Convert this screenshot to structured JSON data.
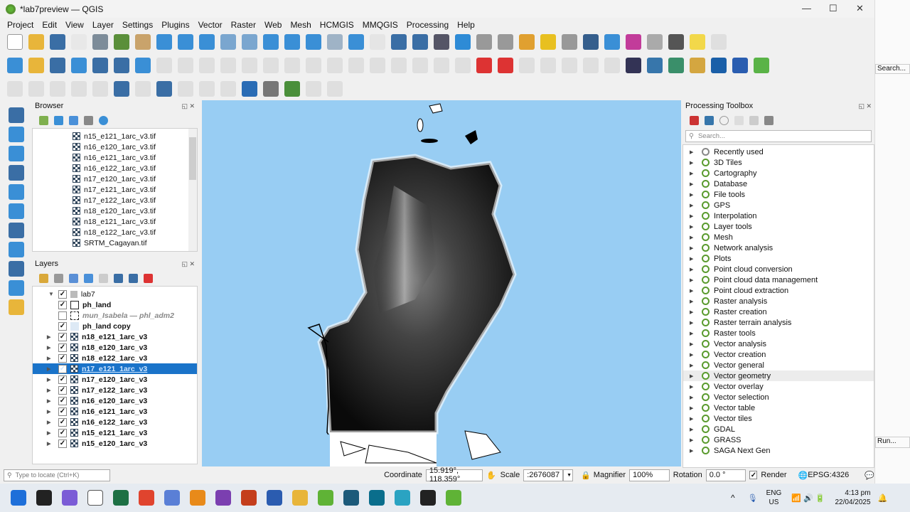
{
  "window": {
    "title": "*lab7preview — QGIS"
  },
  "menu": [
    "Project",
    "Edit",
    "View",
    "Layer",
    "Settings",
    "Plugins",
    "Vector",
    "Raster",
    "Web",
    "Mesh",
    "HCMGIS",
    "MMQGIS",
    "Processing",
    "Help"
  ],
  "toolbar_colors": {
    "row1": [
      "#fff",
      "#e8b53a",
      "#3a6ea5",
      "#e8e8e8",
      "#7d8c99",
      "#5a8f3a",
      "#c9a36b",
      "#3a8fd6",
      "#3a8fd6",
      "#3a8fd6",
      "#7aa6cf",
      "#7aa6cf",
      "#3a8fd6",
      "#3a8fd6",
      "#3a8fd6",
      "#9fb3c6",
      "#3a8fd6",
      "#ccc",
      "#3a6ea5",
      "#3a6ea5",
      "#556",
      "#2e8bd6",
      "#999",
      "#999",
      "#e0a030",
      "#e8c020",
      "#999",
      "#355e8c",
      "#3a8fd6",
      "#c23c9a",
      "#aaa",
      "#555",
      "#f2d84a",
      "#bbb"
    ],
    "row2": [
      "#3a8fd6",
      "#e8b53a",
      "#3a6ea5",
      "#3a8fd6",
      "#3a6ea5",
      "#3a6ea5",
      "#3a8fd6",
      "#bbb",
      "#bbb",
      "#bbb",
      "#bbb",
      "#bbb",
      "#bbb",
      "#bbb",
      "#bbb",
      "#bbb",
      "#bbb",
      "#bbb",
      "#bbb",
      "#bbb",
      "#bbb",
      "#bbb",
      "#d33",
      "#d33",
      "#bbb",
      "#bbb",
      "#bbb",
      "#bbb",
      "#bbb",
      "#335",
      "#3776ab",
      "#3a8f6a",
      "#d4a640",
      "#1a5fa8",
      "#2a5db0",
      "#5ab347"
    ],
    "row3": [
      "#bbb",
      "#bbb",
      "#bbb",
      "#bbb",
      "#bbb",
      "#3a6ea5",
      "#bbb",
      "#3a6ea5",
      "#bbb",
      "#bbb",
      "#bbb",
      "#2a6cb5",
      "#777",
      "#4a8f3a",
      "#bbb",
      "#bbb"
    ],
    "left": [
      "#3a6ea5",
      "#3a8fd6",
      "#3a8fd6",
      "#3a6ea5",
      "#3a8fd6",
      "#3a8fd6",
      "#3a6ea5",
      "#3a8fd6",
      "#3a6ea5",
      "#3a8fd6",
      "#e8b53a"
    ]
  },
  "browser": {
    "title": "Browser",
    "items": [
      "n15_e121_1arc_v3.tif",
      "n16_e120_1arc_v3.tif",
      "n16_e121_1arc_v3.tif",
      "n16_e122_1arc_v3.tif",
      "n17_e120_1arc_v3.tif",
      "n17_e121_1arc_v3.tif",
      "n17_e122_1arc_v3.tif",
      "n18_e120_1arc_v3.tif",
      "n18_e121_1arc_v3.tif",
      "n18_e122_1arc_v3.tif",
      "SRTM_Cagayan.tif"
    ]
  },
  "layers": {
    "title": "Layers",
    "group": "lab7",
    "items": [
      {
        "name": "ph_land",
        "checked": true,
        "type": "poly",
        "expand": false
      },
      {
        "name": "mun_Isabela — phl_adm2",
        "checked": false,
        "type": "dashed",
        "expand": false
      },
      {
        "name": "ph_land copy",
        "checked": true,
        "type": "fill",
        "expand": false
      },
      {
        "name": "n18_e121_1arc_v3",
        "checked": true,
        "type": "raster",
        "expand": true
      },
      {
        "name": "n18_e120_1arc_v3",
        "checked": true,
        "type": "raster",
        "expand": true
      },
      {
        "name": "n18_e122_1arc_v3",
        "checked": true,
        "type": "raster",
        "expand": true
      },
      {
        "name": "n17_e121_1arc_v3",
        "checked": true,
        "type": "raster",
        "expand": true,
        "selected": true
      },
      {
        "name": "n17_e120_1arc_v3",
        "checked": true,
        "type": "raster",
        "expand": true
      },
      {
        "name": "n17_e122_1arc_v3",
        "checked": true,
        "type": "raster",
        "expand": true
      },
      {
        "name": "n16_e120_1arc_v3",
        "checked": true,
        "type": "raster",
        "expand": true
      },
      {
        "name": "n16_e121_1arc_v3",
        "checked": true,
        "type": "raster",
        "expand": true
      },
      {
        "name": "n16_e122_1arc_v3",
        "checked": true,
        "type": "raster",
        "expand": true
      },
      {
        "name": "n15_e121_1arc_v3",
        "checked": true,
        "type": "raster",
        "expand": true
      },
      {
        "name": "n15_e120_1arc_v3",
        "checked": true,
        "type": "raster",
        "expand": true
      }
    ]
  },
  "toolbox": {
    "title": "Processing Toolbox",
    "search_placeholder": "Search...",
    "items": [
      "Recently used",
      "3D Tiles",
      "Cartography",
      "Database",
      "File tools",
      "GPS",
      "Interpolation",
      "Layer tools",
      "Mesh",
      "Network analysis",
      "Plots",
      "Point cloud conversion",
      "Point cloud data management",
      "Point cloud extraction",
      "Raster analysis",
      "Raster creation",
      "Raster terrain analysis",
      "Raster tools",
      "Vector analysis",
      "Vector creation",
      "Vector general",
      "Vector geometry",
      "Vector overlay",
      "Vector selection",
      "Vector table",
      "Vector tiles",
      "GDAL",
      "GRASS",
      "SAGA Next Gen"
    ],
    "highlighted": "Vector geometry"
  },
  "background_window": {
    "search": "Search...",
    "run": "Run..."
  },
  "status": {
    "locate_placeholder": "Type to locate (Ctrl+K)",
    "coordinate_label": "Coordinate",
    "coordinate": "15.919°, 118.359°",
    "scale_label": "Scale",
    "scale": ":2676087",
    "magnifier_label": "Magnifier",
    "magnifier": "100%",
    "rotation_label": "Rotation",
    "rotation": "0.0 °",
    "render_label": "Render",
    "crs": "EPSG:4326"
  },
  "taskbar": {
    "lang1": "ENG",
    "lang2": "US",
    "time": "4:13 pm",
    "date": "22/04/2025",
    "apps": [
      "#1e6fd9",
      "#222",
      "#7b5cd6",
      "#fff",
      "#1d7044",
      "#e0442e",
      "#5a7fd6",
      "#e88a1a",
      "#7b3fb0",
      "#c43e1c",
      "#2b5cb0",
      "#e8b53a",
      "#5fb336",
      "#1c5a7a",
      "#0a6e8c",
      "#2aa3c2",
      "#222",
      "#5fb336"
    ]
  }
}
